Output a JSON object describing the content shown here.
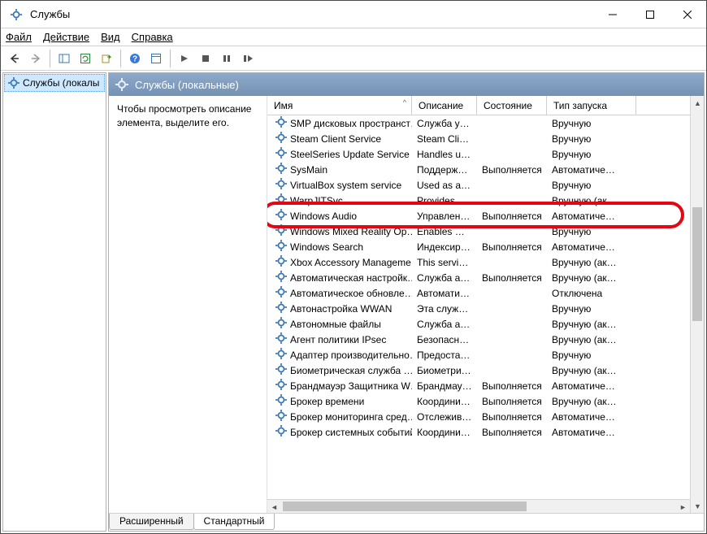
{
  "title": "Службы",
  "menu": {
    "file": "Файл",
    "action": "Действие",
    "view": "Вид",
    "help": "Справка"
  },
  "left": {
    "header": " ",
    "item": "Службы (локалы"
  },
  "right_head": "Службы (локальные)",
  "description_hint": "Чтобы просмотреть описание элемента, выделите его.",
  "columns": {
    "name": "Имя",
    "desc": "Описание",
    "state": "Состояние",
    "startup": "Тип запуска"
  },
  "tabs": {
    "extended": "Расширенный",
    "standard": "Стандартный"
  },
  "services": [
    {
      "name": "SMP дисковых пространст…",
      "desc": "Служба уз…",
      "state": "",
      "startup": "Вручную"
    },
    {
      "name": "Steam Client Service",
      "desc": "Steam Clie…",
      "state": "",
      "startup": "Вручную"
    },
    {
      "name": "SteelSeries Update Service",
      "desc": "Handles u…",
      "state": "",
      "startup": "Вручную"
    },
    {
      "name": "SysMain",
      "desc": "Поддержи…",
      "state": "Выполняется",
      "startup": "Автоматиче…"
    },
    {
      "name": "VirtualBox system service",
      "desc": "Used as a …",
      "state": "",
      "startup": "Вручную"
    },
    {
      "name": "WarpJITSvc",
      "desc": "Provides a…",
      "state": "",
      "startup": "Вручную (ак…"
    },
    {
      "name": "Windows Audio",
      "desc": "Управлен…",
      "state": "Выполняется",
      "startup": "Автоматиче…",
      "hl": true
    },
    {
      "name": "Windows Mixed Reality Op…",
      "desc": "Enables Mi…",
      "state": "",
      "startup": "Вручную"
    },
    {
      "name": "Windows Search",
      "desc": "Индексиро…",
      "state": "Выполняется",
      "startup": "Автоматиче…"
    },
    {
      "name": "Xbox Accessory Manageme…",
      "desc": "This servic…",
      "state": "",
      "startup": "Вручную (ак…"
    },
    {
      "name": "Автоматическая настройк…",
      "desc": "Служба ав…",
      "state": "Выполняется",
      "startup": "Вручную (ак…"
    },
    {
      "name": "Автоматическое обновле…",
      "desc": "Автомати…",
      "state": "",
      "startup": "Отключена"
    },
    {
      "name": "Автонастройка WWAN",
      "desc": "Эта служб…",
      "state": "",
      "startup": "Вручную"
    },
    {
      "name": "Автономные файлы",
      "desc": "Служба ав…",
      "state": "",
      "startup": "Вручную (ак…"
    },
    {
      "name": "Агент политики IPsec",
      "desc": "Безопасно…",
      "state": "",
      "startup": "Вручную (ак…"
    },
    {
      "name": "Адаптер производительно…",
      "desc": "Предостав…",
      "state": "",
      "startup": "Вручную"
    },
    {
      "name": "Биометрическая служба …",
      "desc": "Биометри…",
      "state": "",
      "startup": "Вручную (ак…"
    },
    {
      "name": "Брандмауэр Защитника W…",
      "desc": "Брандмау…",
      "state": "Выполняется",
      "startup": "Автоматиче…"
    },
    {
      "name": "Брокер времени",
      "desc": "Координи…",
      "state": "Выполняется",
      "startup": "Вручную (ак…"
    },
    {
      "name": "Брокер мониторинга сред…",
      "desc": "Отслежива…",
      "state": "Выполняется",
      "startup": "Автоматиче…"
    },
    {
      "name": "Брокер системных событий",
      "desc": "Координи…",
      "state": "Выполняется",
      "startup": "Автоматиче…"
    }
  ]
}
